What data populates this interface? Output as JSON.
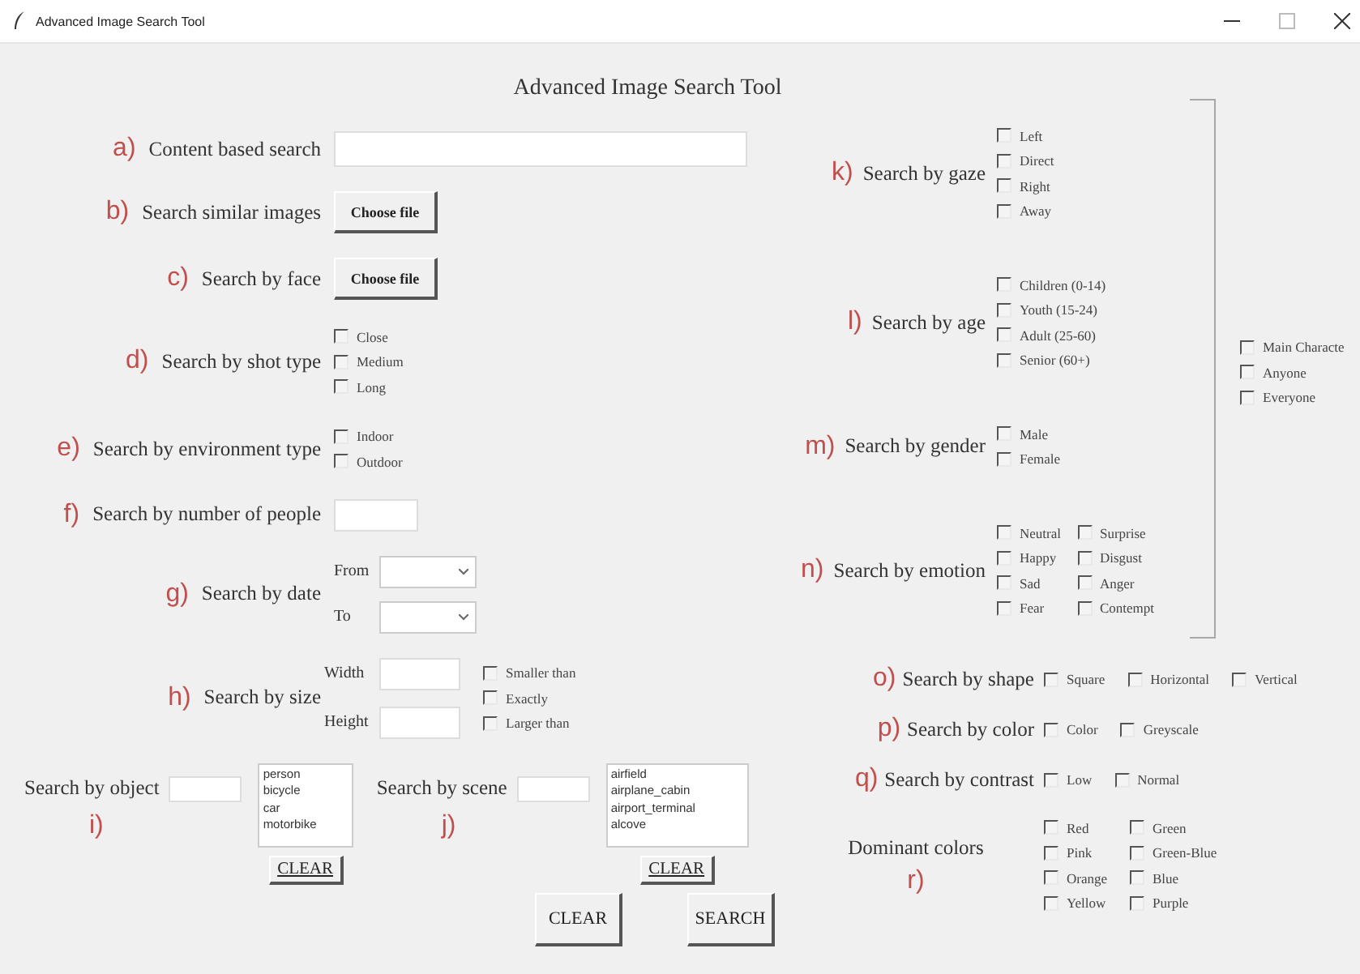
{
  "window": {
    "title": "Advanced Image Search Tool"
  },
  "heading": "Advanced Image Search Tool",
  "left": [
    {
      "kind": "text",
      "marker": "a)",
      "label": "Content based search"
    },
    {
      "kind": "file",
      "marker": "b)",
      "label": "Search similar images",
      "button": "Choose file"
    },
    {
      "kind": "file",
      "marker": "c)",
      "label": "Search by face",
      "button": "Choose file"
    },
    {
      "kind": "checks",
      "marker": "d)",
      "label": "Search by shot type",
      "rows": [
        [
          {
            "label": "Close",
            "checked": false
          }
        ],
        [
          {
            "label": "Medium",
            "checked": false
          }
        ],
        [
          {
            "label": "Long",
            "checked": false
          }
        ]
      ]
    },
    {
      "kind": "checks",
      "marker": "e)",
      "label": "Search by environment type",
      "rows": [
        [
          {
            "label": "Indoor",
            "checked": false
          }
        ],
        [
          {
            "label": "Outdoor",
            "checked": false
          }
        ]
      ]
    },
    {
      "kind": "number",
      "marker": "f)",
      "label": "Search by number of people"
    },
    {
      "kind": "date",
      "marker": "g)",
      "label": "Search by date",
      "from": "From",
      "to": "To"
    },
    {
      "kind": "size",
      "marker": "h)",
      "label": "Search by size",
      "width": "Width",
      "height": "Height",
      "rows": [
        [
          {
            "label": "Smaller than",
            "checked": false
          }
        ],
        [
          {
            "label": "Exactly",
            "checked": false
          }
        ],
        [
          {
            "label": "Larger than",
            "checked": false
          }
        ]
      ]
    }
  ],
  "lists": [
    {
      "label": "Search by object",
      "marker": "i)",
      "items": [
        "person",
        "bicycle",
        "car",
        "motorbike"
      ],
      "clear": "CLEAR"
    },
    {
      "label": "Search by scene",
      "marker": "j)",
      "items": [
        "airfield",
        "airplane_cabin",
        "airport_terminal",
        "alcove"
      ],
      "clear": "CLEAR"
    }
  ],
  "buttons": [
    "CLEAR",
    "SEARCH"
  ],
  "right": [
    {
      "kind": "checks",
      "marker": "k)",
      "label": "Search by gaze",
      "rows": [
        [
          {
            "label": "Left",
            "checked": false
          }
        ],
        [
          {
            "label": "Direct",
            "checked": false
          }
        ],
        [
          {
            "label": "Right",
            "checked": false
          }
        ],
        [
          {
            "label": "Away",
            "checked": false
          }
        ]
      ]
    },
    {
      "kind": "checks",
      "marker": "l)",
      "label": "Search by age",
      "rows": [
        [
          {
            "label": "Children (0-14)",
            "checked": false
          }
        ],
        [
          {
            "label": "Youth (15-24)",
            "checked": false
          }
        ],
        [
          {
            "label": "Adult (25-60)",
            "checked": false
          }
        ],
        [
          {
            "label": "Senior (60+)",
            "checked": false
          }
        ]
      ]
    },
    {
      "kind": "checks",
      "marker": "m)",
      "label": "Search by gender",
      "rows": [
        [
          {
            "label": "Male",
            "checked": false
          }
        ],
        [
          {
            "label": "Female",
            "checked": false
          }
        ]
      ]
    },
    {
      "kind": "checks",
      "marker": "n)",
      "label": "Search by emotion",
      "rows": [
        [
          {
            "label": "Neutral",
            "checked": false
          },
          {
            "label": "Surprise",
            "checked": false
          }
        ],
        [
          {
            "label": "Happy",
            "checked": false
          },
          {
            "label": "Disgust",
            "checked": false
          }
        ],
        [
          {
            "label": "Sad",
            "checked": false
          },
          {
            "label": "Anger",
            "checked": false
          }
        ],
        [
          {
            "label": "Fear",
            "checked": false
          },
          {
            "label": "Contempt",
            "checked": false
          }
        ]
      ]
    }
  ],
  "characters": [
    {
      "label": "Main Characte",
      "checked": false
    },
    {
      "label": "Anyone",
      "checked": false
    },
    {
      "label": "Everyone",
      "checked": false
    }
  ],
  "lower_right": [
    {
      "kind": "checks",
      "marker": "o)",
      "label": "Search by shape",
      "rows": [
        [
          {
            "label": "Square",
            "checked": false
          },
          {
            "label": "Horizontal",
            "checked": false
          },
          {
            "label": "Vertical",
            "checked": false
          }
        ]
      ]
    },
    {
      "kind": "checks",
      "marker": "p)",
      "label": "Search by color",
      "rows": [
        [
          {
            "label": "Color",
            "checked": false
          },
          {
            "label": "Greyscale",
            "checked": false
          }
        ]
      ]
    },
    {
      "kind": "checks",
      "marker": "q)",
      "label": "Search by contrast",
      "rows": [
        [
          {
            "label": "Low",
            "checked": false
          },
          {
            "label": "Normal",
            "checked": false
          }
        ]
      ]
    },
    {
      "kind": "stacked",
      "marker": "r)",
      "label": "Dominant colors",
      "rows": [
        [
          {
            "label": "Red",
            "checked": false
          },
          {
            "label": "Green",
            "checked": false
          }
        ],
        [
          {
            "label": "Pink",
            "checked": false
          },
          {
            "label": "Green-Blue",
            "checked": false
          }
        ],
        [
          {
            "label": "Orange",
            "checked": false
          },
          {
            "label": "Blue",
            "checked": false
          }
        ],
        [
          {
            "label": "Yellow",
            "checked": false
          },
          {
            "label": "Purple",
            "checked": false
          }
        ]
      ]
    }
  ]
}
